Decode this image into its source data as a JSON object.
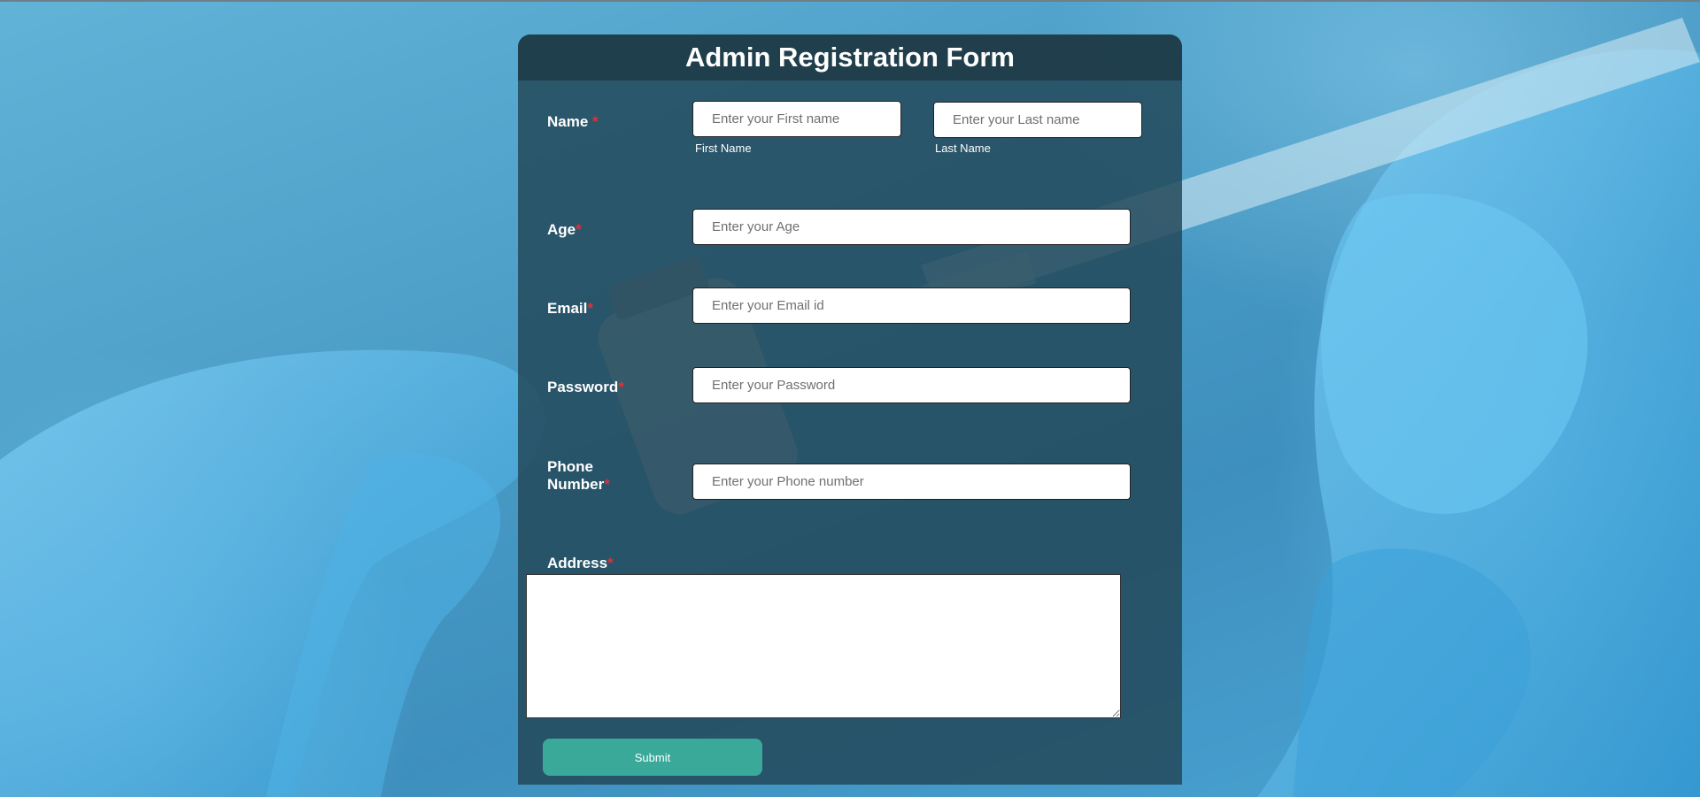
{
  "form": {
    "title": "Admin Registration Form",
    "required_mark": "*",
    "name": {
      "label": "Name",
      "first_placeholder": "Enter your First name",
      "first_sublabel": "First Name",
      "last_placeholder": "Enter your Last name",
      "last_sublabel": "Last Name"
    },
    "age": {
      "label": "Age",
      "placeholder": "Enter your Age"
    },
    "email": {
      "label": "Email",
      "placeholder": "Enter your Email id"
    },
    "password": {
      "label": "Password",
      "placeholder": "Enter your Password"
    },
    "phone": {
      "label_line1": "Phone",
      "label_line2": "Number",
      "placeholder": "Enter your Phone number"
    },
    "address": {
      "label": "Address"
    },
    "submit_label": "Submit"
  },
  "colors": {
    "panel": "#224858",
    "accent_button": "#3aa99a",
    "required": "#e0303a"
  }
}
